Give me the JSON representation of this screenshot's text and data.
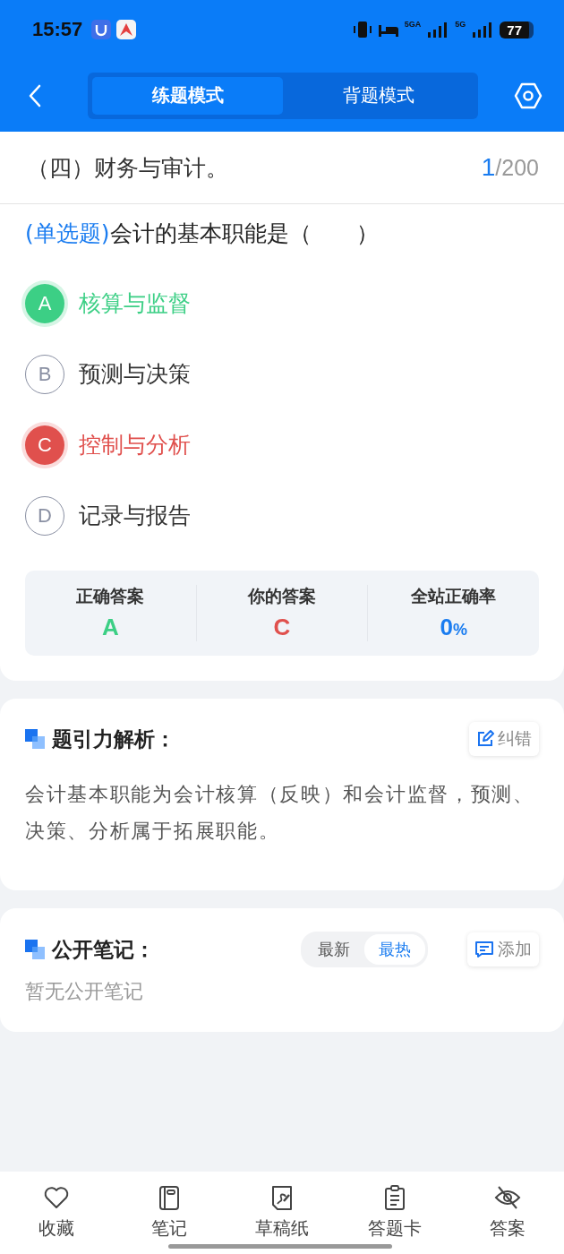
{
  "status_bar": {
    "time": "15:57",
    "network_1": "5GA",
    "network_2": "5G",
    "battery": "77"
  },
  "header": {
    "tabs": [
      {
        "label": "练题模式",
        "selected": true
      },
      {
        "label": "背题模式",
        "selected": false
      }
    ]
  },
  "section": {
    "title": "（四）财务与审计。",
    "current": "1",
    "total": "/200"
  },
  "question": {
    "type": "(单选题)",
    "text": "会计的基本职能是（　　）",
    "options": [
      {
        "letter": "A",
        "text": "核算与监督",
        "kind": "correct"
      },
      {
        "letter": "B",
        "text": "预测与决策",
        "kind": "neutral"
      },
      {
        "letter": "C",
        "text": "控制与分析",
        "kind": "wrong"
      },
      {
        "letter": "D",
        "text": "记录与报告",
        "kind": "neutral"
      }
    ],
    "summary": [
      {
        "label": "正确答案",
        "value": "A",
        "kind": "correct"
      },
      {
        "label": "你的答案",
        "value": "C",
        "kind": "wrong"
      },
      {
        "label": "全站正确率",
        "value": "0",
        "unit": "%",
        "kind": "rate"
      }
    ]
  },
  "analysis": {
    "title": "题引力解析：",
    "action": "纠错",
    "text": "会计基本职能为会计核算（反映）和会计监督，预测、决策、分析属于拓展职能。"
  },
  "notes": {
    "title": "公开笔记：",
    "sort_tabs": [
      {
        "label": "最新",
        "selected": false
      },
      {
        "label": "最热",
        "selected": true
      }
    ],
    "action": "添加",
    "empty": "暂无公开笔记"
  },
  "bottom_nav": [
    {
      "label": "收藏"
    },
    {
      "label": "笔记"
    },
    {
      "label": "草稿纸"
    },
    {
      "label": "答题卡"
    },
    {
      "label": "答案"
    }
  ]
}
